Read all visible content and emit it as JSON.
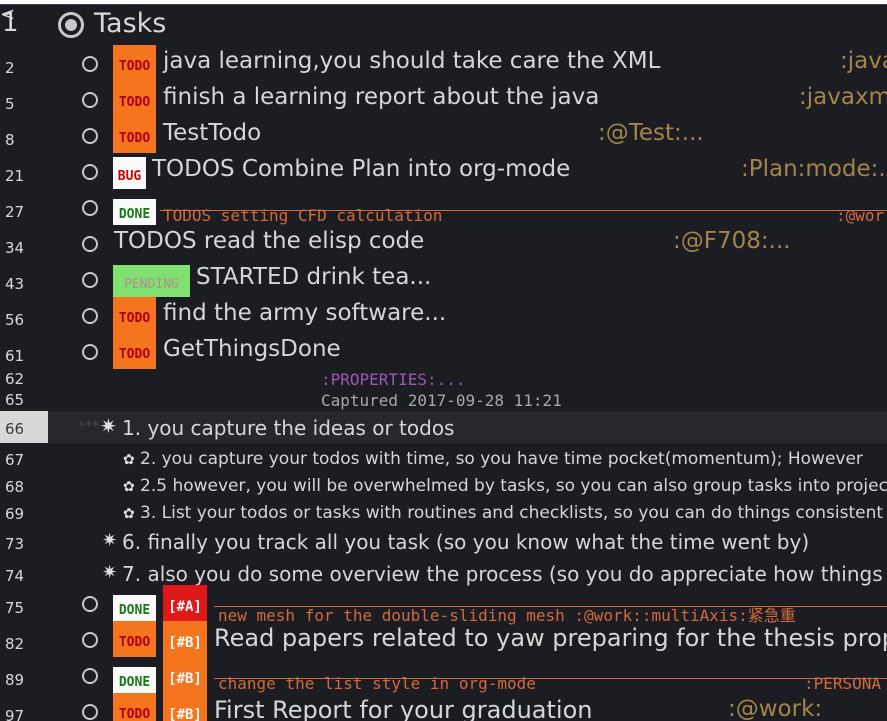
{
  "editor": {
    "corner_mark": "<",
    "heading": {
      "line": "1",
      "title": "Tasks"
    },
    "tasks": [
      {
        "line": "2",
        "keyword": "TODO",
        "title": "java learning,you should take care the XML",
        "tags": ":java"
      },
      {
        "line": "5",
        "keyword": "TODO",
        "title": "finish a learning report about the java",
        "tags": ":javaxm"
      },
      {
        "line": "8",
        "keyword": "TODO",
        "title": "TestTodo",
        "tags": ":@Test:..."
      },
      {
        "line": "21",
        "keyword": "BUG",
        "title": "TODOS Combine Plan into org-mode",
        "tags": ":Plan:mode:."
      },
      {
        "line": "27",
        "keyword": "DONE",
        "title": "TODOS setting CFD calculation",
        "tags": ":@wor"
      },
      {
        "line": "34",
        "keyword": "",
        "title": "TODOS read the elisp code",
        "tags": ":@F708:..."
      },
      {
        "line": "43",
        "keyword": "PENDING",
        "title": "STARTED drink tea...",
        "tags": ""
      },
      {
        "line": "56",
        "keyword": "TODO",
        "title": "find the army software...",
        "tags": ""
      },
      {
        "line": "61",
        "keyword": "TODO",
        "title": "GetThingsDone",
        "tags": ""
      }
    ],
    "properties": {
      "line": "62",
      "text": ":PROPERTIES:..."
    },
    "captured": {
      "line": "65",
      "text": "Captured 2017-09-28 11:21"
    },
    "list_items": [
      {
        "line": "66",
        "hidden_stars": "***",
        "bullet": "✷",
        "text": "1. you capture the ideas or todos",
        "current": true
      },
      {
        "line": "67",
        "bullet": "✿",
        "text": "2. you capture your todos with time, so you have time pocket(momentum); However"
      },
      {
        "line": "68",
        "bullet": "✿",
        "text": "2.5 however, you will be overwhelmed by tasks, so you can also group tasks into projec"
      },
      {
        "line": "69",
        "bullet": "✿",
        "text": "3. List your todos or tasks with routines and checklists, so you can do things consistent"
      },
      {
        "line": "73",
        "bullet": "✷",
        "text": "6. finally you track all you task (so you know what the time went by)"
      },
      {
        "line": "74",
        "bullet": "✷",
        "text": "7. also you do some overview the process (so you do appreciate how things a"
      }
    ],
    "priority_tasks": [
      {
        "line": "75",
        "keyword": "DONE",
        "priority": "[#A]",
        "title": "new mesh for the double-sliding mesh :@work::multiAxis:紧急重",
        "tags": ""
      },
      {
        "line": "82",
        "keyword": "TODO",
        "priority": "[#B]",
        "title": "Read papers related to yaw preparing for the thesis propo",
        "tags": ""
      },
      {
        "line": "89",
        "keyword": "DONE",
        "priority": "[#B]",
        "title": "change the list style in org-mode",
        "tags": ":PERSONA"
      },
      {
        "line": "97",
        "keyword": "TODO",
        "priority": "[#B]",
        "title": "First Report for your graduation",
        "tags": ":@work:"
      }
    ],
    "colors": {
      "background": "#1b1d23",
      "todo": "#f5741e",
      "done": "#167a16",
      "bug": "#d00000",
      "pending": "#80e070",
      "priority_a": "#e01818",
      "tag": "#a48548",
      "properties": "#9b5ab0"
    }
  }
}
